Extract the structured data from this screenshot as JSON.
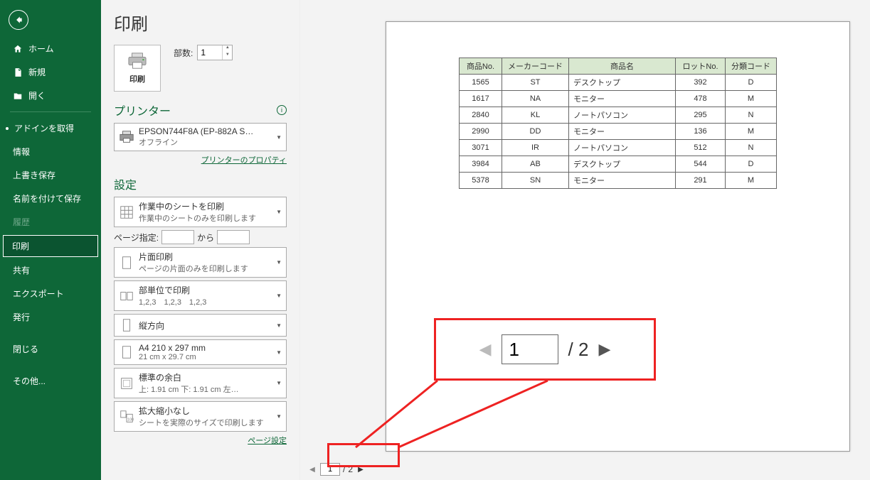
{
  "sidebar": {
    "items": [
      {
        "label": "ホーム",
        "icon": "home"
      },
      {
        "label": "新規",
        "icon": "new"
      },
      {
        "label": "開く",
        "icon": "open"
      }
    ],
    "items2": [
      {
        "label": "アドインを取得",
        "bullet": true
      },
      {
        "label": "情報"
      },
      {
        "label": "上書き保存"
      },
      {
        "label": "名前を付けて保存"
      },
      {
        "label": "履歴",
        "disabled": true
      },
      {
        "label": "印刷",
        "active": true
      },
      {
        "label": "共有"
      },
      {
        "label": "エクスポート"
      },
      {
        "label": "発行"
      },
      {
        "label": "閉じる"
      },
      {
        "label": "その他..."
      }
    ]
  },
  "panel": {
    "title": "印刷",
    "print_button": "印刷",
    "copies_label": "部数:",
    "copies_value": "1",
    "printer_heading": "プリンター",
    "printer_name": "EPSON744F8A (EP-882A S…",
    "printer_status": "オフライン",
    "printer_props": "プリンターのプロパティ",
    "settings_heading": "設定",
    "setting_sheet_l1": "作業中のシートを印刷",
    "setting_sheet_l2": "作業中のシートのみを印刷します",
    "pages_label": "ページ指定:",
    "pages_sep": "から",
    "setting_side_l1": "片面印刷",
    "setting_side_l2": "ページの片面のみを印刷します",
    "setting_collate_l1": "部単位で印刷",
    "setting_collate_l2": "1,2,3　1,2,3　1,2,3",
    "setting_orient": "縦方向",
    "setting_paper_l1": "A4 210 x 297 mm",
    "setting_paper_l2": "21 cm x 29.7 cm",
    "setting_margin_l1": "標準の余白",
    "setting_margin_l2": "上: 1.91 cm 下: 1.91 cm 左…",
    "setting_scale_l1": "拡大縮小なし",
    "setting_scale_l2": "シートを実際のサイズで印刷します",
    "page_setup": "ページ設定"
  },
  "preview": {
    "headers": [
      "商品No.",
      "メーカーコード",
      "商品名",
      "ロットNo.",
      "分類コード"
    ],
    "rows": [
      [
        "1565",
        "ST",
        "デスクトップ",
        "392",
        "D"
      ],
      [
        "1617",
        "NA",
        "モニター",
        "478",
        "M"
      ],
      [
        "2840",
        "KL",
        "ノートパソコン",
        "295",
        "N"
      ],
      [
        "2990",
        "DD",
        "モニター",
        "136",
        "M"
      ],
      [
        "3071",
        "IR",
        "ノートパソコン",
        "512",
        "N"
      ],
      [
        "3984",
        "AB",
        "デスクトップ",
        "544",
        "D"
      ],
      [
        "5378",
        "SN",
        "モニター",
        "291",
        "M"
      ]
    ]
  },
  "pager": {
    "current": "1",
    "total": "2"
  },
  "callout": {
    "current": "1",
    "total": "2"
  }
}
